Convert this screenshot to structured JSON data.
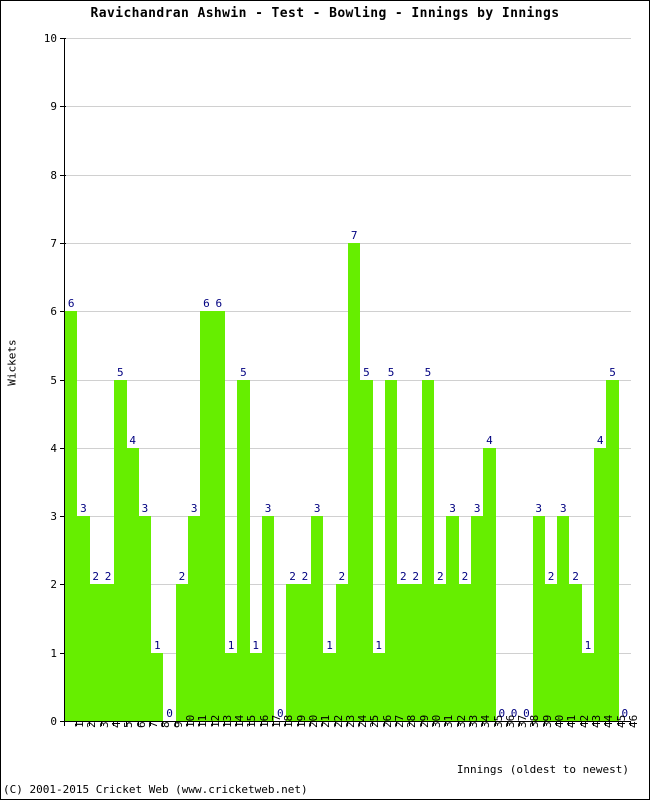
{
  "title": "Ravichandran Ashwin - Test - Bowling - Innings by Innings",
  "footer": "(C) 2001-2015 Cricket Web (www.cricketweb.net)",
  "colors": {
    "bar": "#66ee00",
    "value_label": "#000080",
    "grid": "#d0d0d0",
    "axis": "#000000",
    "background": "#ffffff"
  },
  "chart_data": {
    "type": "bar",
    "title": "Ravichandran Ashwin - Test - Bowling - Innings by Innings",
    "xlabel": "Innings (oldest to newest)",
    "ylabel": "Wickets",
    "ylim": [
      0,
      10
    ],
    "ytick_labels": [
      "0",
      "1",
      "2",
      "3",
      "4",
      "5",
      "6",
      "7",
      "8",
      "9",
      "10"
    ],
    "yticks": [
      0,
      1,
      2,
      3,
      4,
      5,
      6,
      7,
      8,
      9,
      10
    ],
    "grid": true,
    "legend": null,
    "categories": [
      "1",
      "2",
      "3",
      "4",
      "5",
      "6",
      "7",
      "8",
      "9",
      "10",
      "11",
      "12",
      "13",
      "14",
      "15",
      "16",
      "17",
      "18",
      "19",
      "20",
      "21",
      "22",
      "23",
      "24",
      "25",
      "26",
      "27",
      "28",
      "29",
      "30",
      "31",
      "32",
      "33",
      "34",
      "35",
      "36",
      "37",
      "38",
      "39",
      "40",
      "41",
      "42",
      "43",
      "44",
      "45",
      "46"
    ],
    "values": [
      6,
      3,
      2,
      2,
      5,
      4,
      3,
      1,
      0,
      2,
      3,
      6,
      6,
      1,
      5,
      1,
      3,
      0,
      2,
      2,
      3,
      1,
      2,
      7,
      5,
      1,
      5,
      2,
      2,
      5,
      2,
      3,
      2,
      3,
      4,
      0,
      0,
      0,
      3,
      2,
      3,
      2,
      1,
      4,
      5,
      0
    ],
    "data_labels": [
      "6",
      "3",
      "2",
      "2",
      "5",
      "4",
      "3",
      "1",
      "0",
      "2",
      "3",
      "6",
      "6",
      "1",
      "5",
      "1",
      "3",
      "0",
      "2",
      "2",
      "3",
      "1",
      "2",
      "7",
      "5",
      "1",
      "5",
      "2",
      "2",
      "5",
      "2",
      "3",
      "2",
      "3",
      "4",
      "0",
      "0",
      "0",
      "3",
      "2",
      "3",
      "2",
      "1",
      "4",
      "5",
      "0"
    ]
  }
}
